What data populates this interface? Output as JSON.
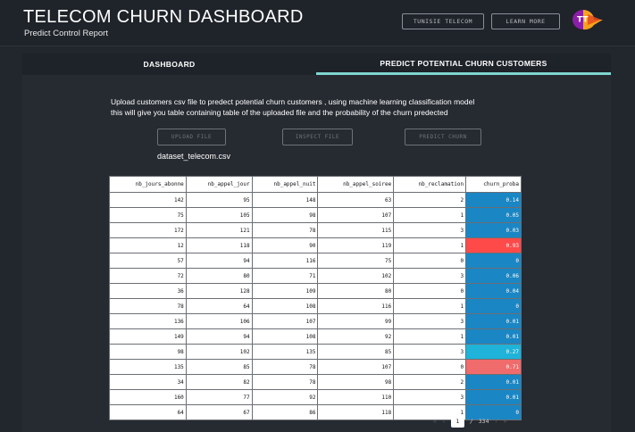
{
  "header": {
    "title": "TELECOM CHURN DASHBOARD",
    "subtitle": "Predict Control Report",
    "buttons": [
      "TUNISIE TELECOM",
      "LEARN MORE"
    ],
    "logo_text": "TT"
  },
  "tabs": [
    {
      "label": "DASHBOARD",
      "active": false
    },
    {
      "label": "PREDICT POTENTIAL CHURN CUSTOMERS",
      "active": true
    }
  ],
  "description": [
    "Upload customers csv file to predect potential churn customers , using machine learning classification model",
    "this will give you table containing table of the uploaded file and the probability of the churn predected"
  ],
  "actions": {
    "upload": "UPLOAD FILE",
    "inspect": "INSPECT FILE",
    "predict": "PREDICT CHURN"
  },
  "file_name": "dataset_telecom.csv",
  "table": {
    "columns": [
      "nb_jours_abonne",
      "nb_appel_jour",
      "nb_appel_nuit",
      "nb_appel_soiree",
      "nb_reclamation",
      "churn_proba"
    ],
    "rows": [
      [
        "142",
        "95",
        "148",
        "63",
        "2",
        "0.14"
      ],
      [
        "75",
        "105",
        "98",
        "107",
        "1",
        "0.05"
      ],
      [
        "172",
        "121",
        "78",
        "115",
        "3",
        "0.03"
      ],
      [
        "12",
        "118",
        "90",
        "119",
        "1",
        "0.93"
      ],
      [
        "57",
        "94",
        "116",
        "75",
        "0",
        "0"
      ],
      [
        "72",
        "80",
        "71",
        "102",
        "3",
        "0.06"
      ],
      [
        "36",
        "128",
        "109",
        "80",
        "0",
        "0.04"
      ],
      [
        "78",
        "64",
        "108",
        "116",
        "1",
        "0"
      ],
      [
        "136",
        "106",
        "107",
        "99",
        "3",
        "0.01"
      ],
      [
        "149",
        "94",
        "108",
        "92",
        "1",
        "0.01"
      ],
      [
        "98",
        "102",
        "135",
        "85",
        "3",
        "0.27"
      ],
      [
        "135",
        "85",
        "78",
        "107",
        "0",
        "0.71"
      ],
      [
        "34",
        "82",
        "78",
        "98",
        "2",
        "0.01"
      ],
      [
        "160",
        "77",
        "92",
        "110",
        "3",
        "0.01"
      ],
      [
        "64",
        "67",
        "86",
        "118",
        "1",
        "0"
      ]
    ]
  },
  "colors": {
    "low": "#1a86c4",
    "mid": "#1fb3d9",
    "high": "#f06b6b",
    "very_high": "#ff4a4a"
  },
  "pagination": {
    "first": "«",
    "prev": "‹",
    "current": "1",
    "separator": "/",
    "total": "334",
    "next": "›",
    "last": "»"
  }
}
